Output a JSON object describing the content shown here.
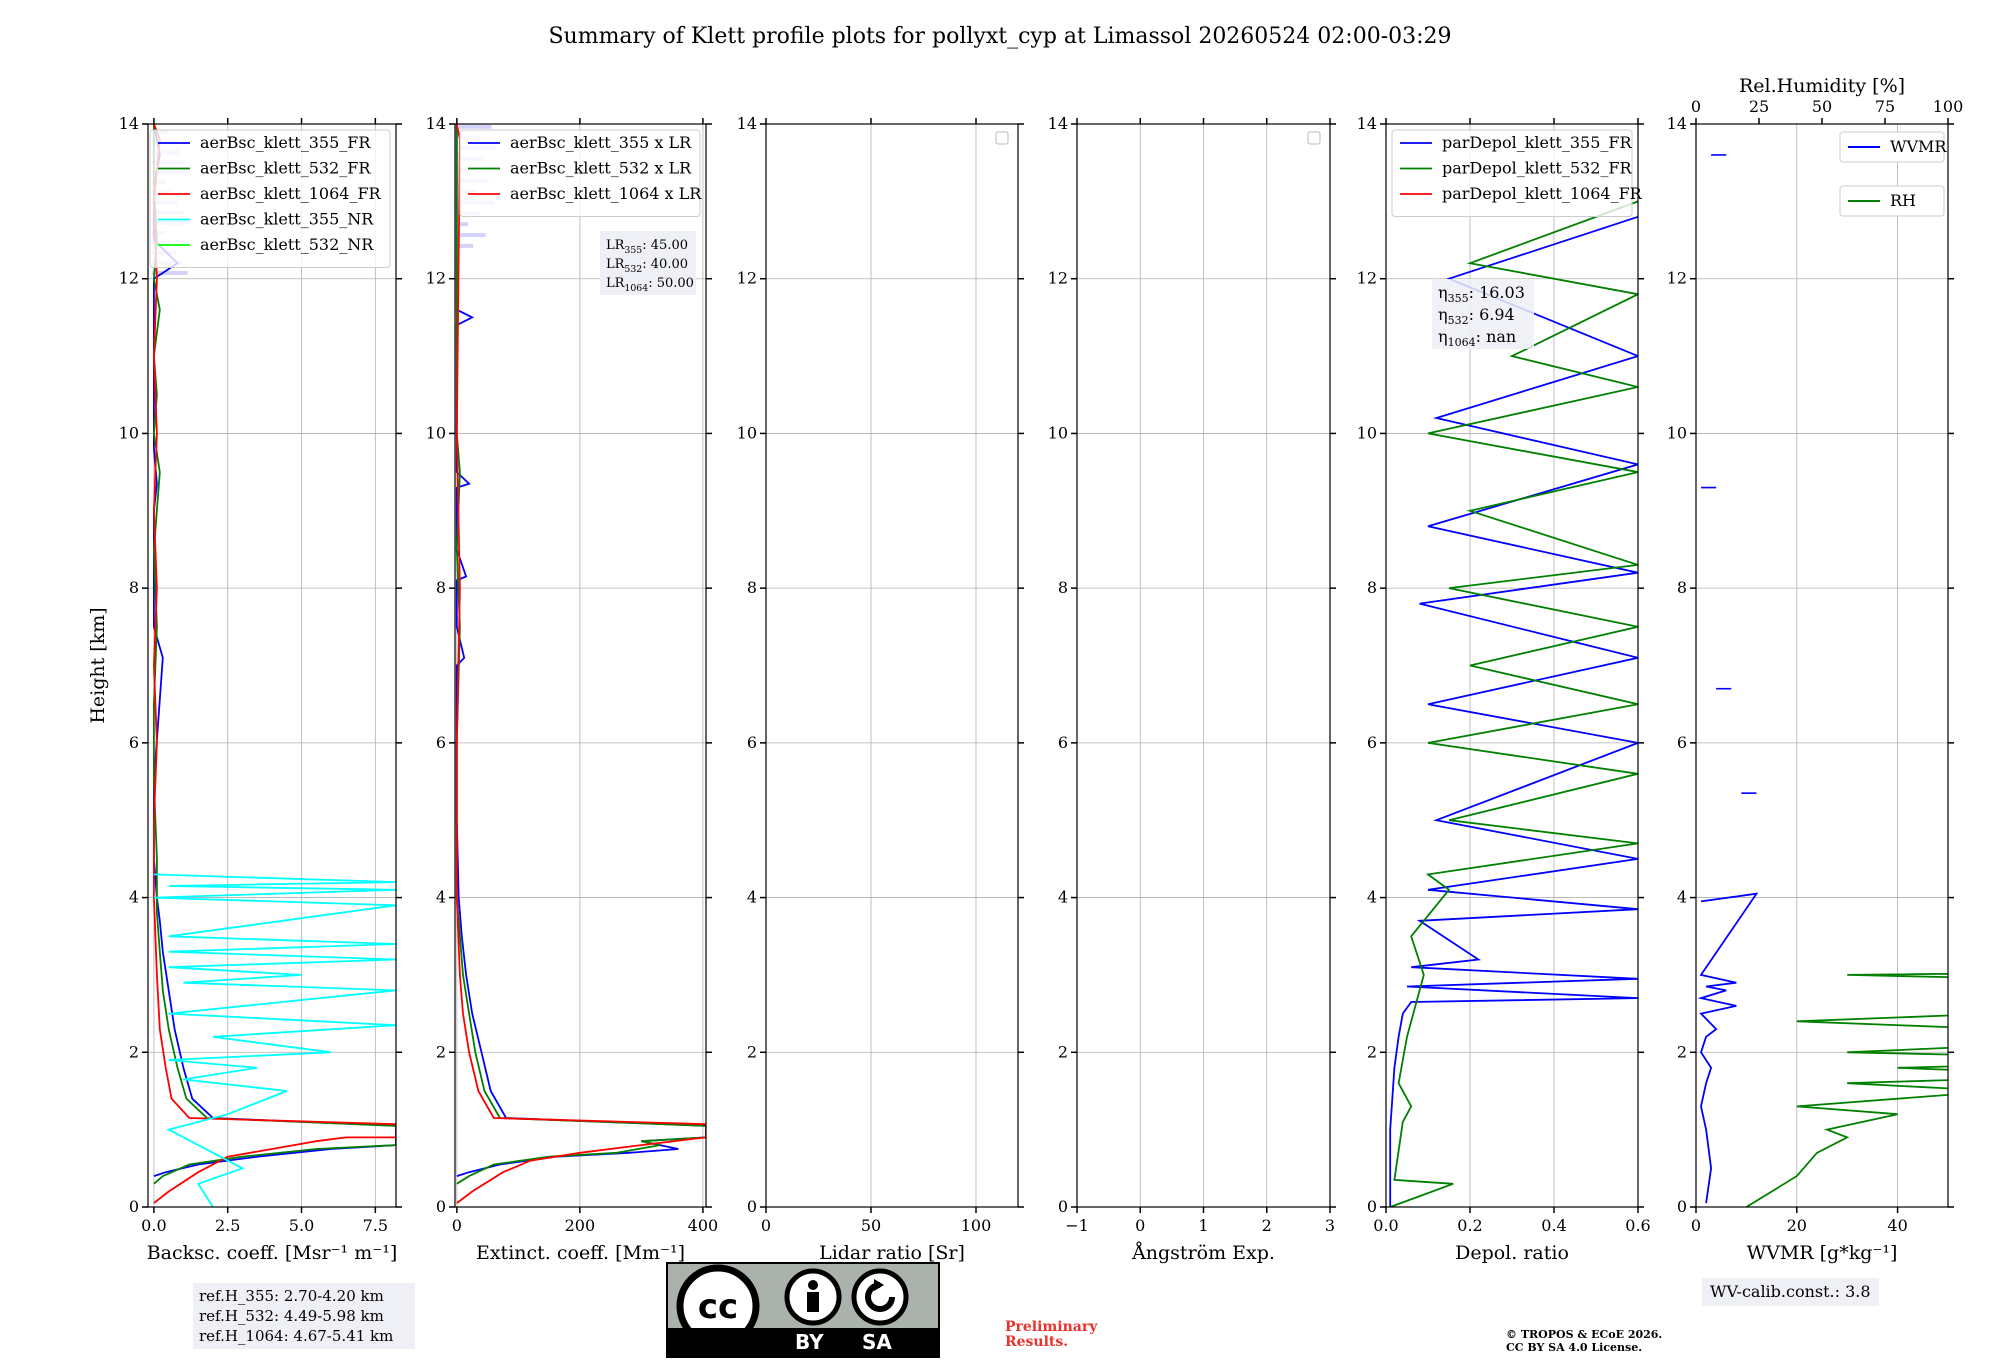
{
  "title": "Summary of Klett profile plots for pollyxt_cyp at Limassol 20260524 02:00-03:29",
  "colors": {
    "c355": "#0000ff",
    "c532": "#008000",
    "c1064": "#ff0000",
    "c355nr": "#00ffff",
    "c532nr": "#00ff00"
  },
  "chart_data": [
    {
      "type": "line",
      "panel": "backscatter",
      "xlabel": "Backsc. coeff. [Msr⁻¹ m⁻¹]",
      "ylabel": "Height [km]",
      "xlim": [
        -0.2,
        8.2
      ],
      "ylim": [
        0,
        14
      ],
      "xticks": [
        0,
        2.5,
        5,
        7.5
      ],
      "xticklabels": [
        "0.0",
        "2.5",
        "5.0",
        "7.5"
      ],
      "yticks": [
        0,
        2,
        4,
        6,
        8,
        10,
        12,
        14
      ],
      "legend": [
        "aerBsc_klett_355_FR",
        "aerBsc_klett_532_FR",
        "aerBsc_klett_1064_FR",
        "aerBsc_klett_355_NR",
        "aerBsc_klett_532_NR"
      ],
      "legend_loc": "upper right",
      "series": [
        {
          "name": "aerBsc_klett_355_FR",
          "color": "#0000ff",
          "x": [
            0.0,
            0.4,
            1.5,
            3.5,
            6.0,
            8.2,
            8.2,
            2.0,
            1.3,
            1.0,
            0.7,
            0.5,
            0.3,
            0.2,
            0.1,
            0.0,
            0.0,
            0.3,
            0.0,
            0.0,
            0.0,
            0.0,
            0.1,
            0.0,
            0.0,
            0.0,
            0.0,
            0.0,
            0.0,
            0.0,
            0.8,
            0.0,
            0.0,
            0.0,
            0.2,
            0.0
          ],
          "y": [
            0.4,
            0.45,
            0.55,
            0.65,
            0.75,
            0.8,
            1.05,
            1.15,
            1.4,
            1.8,
            2.3,
            2.8,
            3.3,
            3.7,
            4.0,
            4.5,
            5.5,
            7.1,
            7.5,
            8.1,
            8.5,
            9.0,
            9.35,
            9.8,
            10.5,
            11.0,
            11.4,
            11.5,
            11.7,
            12.0,
            12.2,
            12.5,
            12.8,
            13.2,
            13.6,
            14.0
          ]
        },
        {
          "name": "aerBsc_klett_532_FR",
          "color": "#008000",
          "x": [
            0.0,
            0.3,
            1.2,
            3.0,
            5.5,
            8.2,
            8.2,
            1.8,
            1.1,
            0.8,
            0.5,
            0.3,
            0.2,
            0.1,
            0.1,
            0.0,
            0.0,
            0.1,
            0.0,
            0.2,
            0.0,
            0.1,
            0.0,
            0.2,
            0.0,
            0.1,
            0.0,
            0.0
          ],
          "y": [
            0.3,
            0.4,
            0.55,
            0.65,
            0.75,
            0.8,
            1.05,
            1.15,
            1.4,
            1.8,
            2.3,
            2.8,
            3.3,
            3.8,
            4.5,
            5.5,
            6.5,
            7.5,
            8.5,
            9.5,
            10.0,
            10.5,
            11.0,
            11.6,
            12.0,
            12.5,
            13.2,
            14.0
          ]
        },
        {
          "name": "aerBsc_klett_1064_FR",
          "color": "#ff0000",
          "x": [
            0.0,
            0.5,
            1.5,
            2.5,
            4.0,
            5.5,
            6.5,
            8.2,
            8.2,
            1.2,
            0.6,
            0.4,
            0.2,
            0.1,
            0.0,
            0.0,
            0.1,
            0.0,
            0.1,
            0.0,
            0.1,
            0.0,
            0.1,
            0.0,
            0.2,
            0.0
          ],
          "y": [
            0.05,
            0.2,
            0.45,
            0.65,
            0.75,
            0.85,
            0.9,
            0.9,
            1.07,
            1.15,
            1.4,
            1.8,
            2.3,
            3.0,
            4.0,
            5.0,
            6.0,
            7.0,
            8.0,
            9.0,
            10.0,
            11.0,
            12.0,
            13.0,
            13.8,
            14.0
          ]
        },
        {
          "name": "aerBsc_klett_355_NR",
          "color": "#00ffff",
          "x": [
            2.0,
            1.5,
            3.0,
            2.0,
            0.5,
            2.5,
            4.5,
            1.0,
            3.5,
            0.5,
            6.0,
            2.0,
            8.2,
            0.5,
            8.2,
            1.0,
            5.0,
            0.5,
            8.2,
            0.5,
            8.2,
            0.5,
            8.2,
            0.0,
            8.2,
            0.5,
            8.2,
            0.0
          ],
          "y": [
            0.0,
            0.3,
            0.5,
            0.7,
            1.0,
            1.2,
            1.5,
            1.65,
            1.8,
            1.9,
            2.0,
            2.2,
            2.35,
            2.5,
            2.8,
            2.9,
            3.0,
            3.1,
            3.2,
            3.3,
            3.4,
            3.5,
            3.9,
            4.0,
            4.1,
            4.15,
            4.2,
            4.3
          ]
        },
        {
          "name": "aerBsc_klett_532_NR",
          "color": "#00ff00",
          "x": [],
          "y": []
        }
      ],
      "shaded_noise_top_km": [
        12.0,
        14.0
      ]
    },
    {
      "type": "line",
      "panel": "extinction",
      "xlabel": "Extinct. coeff. [Mm⁻¹]",
      "xlim": [
        -3,
        405
      ],
      "ylim": [
        0,
        14
      ],
      "xticks": [
        0,
        200,
        400
      ],
      "xticklabels": [
        "0",
        "200",
        "400"
      ],
      "yticks": [
        0,
        2,
        4,
        6,
        8,
        10,
        12,
        14
      ],
      "legend": [
        "aerBsc_klett_355 x LR",
        "aerBsc_klett_532 x LR",
        "aerBsc_klett_1064 x LR"
      ],
      "legend_loc": "upper right",
      "lidar_ratios": [
        "LR355: 45.00",
        "LR532: 40.00",
        "LR1064: 50.00"
      ],
      "series": [
        {
          "name": "aerBsc_klett_355 x LR",
          "color": "#0000ff",
          "x": [
            0,
            20,
            70,
            160,
            280,
            360,
            330,
            300,
            405,
            405,
            80,
            55,
            40,
            25,
            15,
            8,
            3,
            0,
            0,
            12,
            0,
            0,
            15,
            0,
            0,
            20,
            0,
            0,
            25,
            0,
            0
          ],
          "y": [
            0.4,
            0.45,
            0.55,
            0.65,
            0.7,
            0.75,
            0.8,
            0.85,
            0.9,
            1.05,
            1.15,
            1.5,
            2.0,
            2.5,
            3.0,
            3.5,
            4.0,
            5.0,
            7.0,
            7.1,
            7.5,
            8.1,
            8.15,
            8.5,
            9.3,
            9.35,
            9.5,
            11.4,
            11.5,
            11.6,
            14.0
          ]
        },
        {
          "name": "aerBsc_klett_532 x LR",
          "color": "#008000",
          "x": [
            0,
            20,
            60,
            150,
            260,
            330,
            300,
            405,
            405,
            70,
            45,
            30,
            20,
            10,
            5,
            0,
            0,
            5,
            0,
            5,
            0,
            0
          ],
          "y": [
            0.3,
            0.4,
            0.55,
            0.65,
            0.7,
            0.8,
            0.85,
            0.9,
            1.05,
            1.15,
            1.5,
            2.0,
            2.5,
            3.0,
            3.5,
            4.0,
            6.0,
            7.5,
            8.5,
            9.5,
            10.0,
            14.0
          ]
        },
        {
          "name": "aerBsc_klett_1064 x LR",
          "color": "#ff0000",
          "x": [
            0,
            25,
            75,
            120,
            200,
            300,
            405,
            405,
            60,
            35,
            20,
            10,
            5,
            0,
            0,
            5,
            0,
            5,
            0
          ],
          "y": [
            0.05,
            0.2,
            0.45,
            0.6,
            0.7,
            0.8,
            0.9,
            1.07,
            1.15,
            1.5,
            2.0,
            2.5,
            3.0,
            4.0,
            6.0,
            8.0,
            10.0,
            13.8,
            14.0
          ]
        }
      ]
    },
    {
      "type": "line",
      "panel": "lidar_ratio",
      "xlabel": "Lidar ratio [Sr]",
      "xlim": [
        0,
        120
      ],
      "ylim": [
        0,
        14
      ],
      "xticks": [
        0,
        50,
        100
      ],
      "xticklabels": [
        "0",
        "50",
        "100"
      ],
      "yticks": [
        0,
        2,
        4,
        6,
        8,
        10,
        12,
        14
      ],
      "series": []
    },
    {
      "type": "line",
      "panel": "angstrom",
      "xlabel": "Ångström Exp.",
      "xlim": [
        -1,
        3
      ],
      "ylim": [
        0,
        14
      ],
      "xticks": [
        -1,
        0,
        1,
        2,
        3
      ],
      "xticklabels": [
        "−1",
        "0",
        "1",
        "2",
        "3"
      ],
      "yticks": [
        0,
        2,
        4,
        6,
        8,
        10,
        12,
        14
      ],
      "series": []
    },
    {
      "type": "line",
      "panel": "depolarization",
      "xlabel": "Depol. ratio",
      "xlim": [
        0,
        0.6
      ],
      "ylim": [
        0,
        14
      ],
      "xticks": [
        0,
        0.2,
        0.4,
        0.6
      ],
      "xticklabels": [
        "0.0",
        "0.2",
        "0.4",
        "0.6"
      ],
      "yticks": [
        0,
        2,
        4,
        6,
        8,
        10,
        12,
        14
      ],
      "legend": [
        "parDepol_klett_355_FR",
        "parDepol_klett_532_FR",
        "parDepol_klett_1064_FR"
      ],
      "legend_loc": "upper right",
      "eta": [
        "η355: 16.03",
        "η532: 6.94",
        "η1064: nan"
      ],
      "series": [
        {
          "name": "parDepol_klett_355_FR",
          "color": "#0000ff",
          "x": [
            0.01,
            0.01,
            0.02,
            0.03,
            0.04,
            0.06,
            0.6,
            0.05,
            0.6,
            0.06,
            0.22,
            0.08,
            0.6,
            0.1,
            0.6,
            0.12,
            0.6,
            0.1,
            0.6,
            0.08,
            0.6,
            0.1,
            0.6,
            0.12,
            0.6,
            0.15,
            0.6
          ],
          "y": [
            0.0,
            1.0,
            1.8,
            2.2,
            2.5,
            2.65,
            2.7,
            2.85,
            2.95,
            3.1,
            3.2,
            3.7,
            3.85,
            4.1,
            4.5,
            5.0,
            6.0,
            6.5,
            7.1,
            7.8,
            8.2,
            8.8,
            9.6,
            10.2,
            11.0,
            12.0,
            12.8
          ]
        },
        {
          "name": "parDepol_klett_532_FR",
          "color": "#008000",
          "x": [
            0.01,
            0.16,
            0.02,
            0.04,
            0.06,
            0.03,
            0.05,
            0.09,
            0.06,
            0.15,
            0.1,
            0.6,
            0.15,
            0.6,
            0.1,
            0.6,
            0.2,
            0.6,
            0.15,
            0.6,
            0.2,
            0.6,
            0.1,
            0.6,
            0.3,
            0.6,
            0.2,
            0.6
          ],
          "y": [
            0.0,
            0.3,
            0.35,
            1.1,
            1.3,
            1.6,
            2.2,
            3.0,
            3.5,
            4.1,
            4.3,
            4.7,
            5.0,
            5.6,
            6.0,
            6.5,
            7.0,
            7.5,
            8.0,
            8.3,
            9.0,
            9.5,
            10.0,
            10.6,
            11.0,
            11.8,
            12.2,
            13.0
          ]
        },
        {
          "name": "parDepol_klett_1064_FR",
          "color": "#ff0000",
          "x": [],
          "y": []
        }
      ]
    },
    {
      "type": "line",
      "panel": "water_vapor",
      "xlabel": "WVMR [g*kg⁻¹]",
      "x2label": "Rel.Humidity [%]",
      "xlim": [
        0,
        50
      ],
      "x2lim": [
        0,
        100
      ],
      "ylim": [
        0,
        14
      ],
      "xticks": [
        0,
        20,
        40
      ],
      "xticklabels": [
        "0",
        "20",
        "40"
      ],
      "x2ticks": [
        0,
        25,
        50,
        75,
        100
      ],
      "x2ticklabels": [
        "0",
        "25",
        "50",
        "75",
        "100"
      ],
      "yticks": [
        0,
        2,
        4,
        6,
        8,
        10,
        12,
        14
      ],
      "legend": [
        "WVMR",
        "RH"
      ],
      "series": [
        {
          "name": "WVMR",
          "color": "#0000ff",
          "x": [
            2,
            3,
            2,
            1,
            2,
            3,
            1,
            2,
            4,
            1,
            8,
            1,
            6,
            2,
            8,
            1,
            12,
            1
          ],
          "y": [
            0.05,
            0.5,
            1.0,
            1.3,
            1.6,
            1.8,
            2.0,
            2.2,
            2.3,
            2.5,
            2.6,
            2.7,
            2.8,
            2.85,
            2.9,
            3.0,
            4.05,
            3.95
          ]
        },
        {
          "name": "RH",
          "color": "#008000",
          "x": [
            10,
            20,
            24,
            30,
            26,
            40,
            20,
            60,
            30,
            80,
            40,
            100,
            30,
            100,
            20,
            100,
            60,
            100,
            30,
            100
          ],
          "y": [
            0.0,
            0.4,
            0.7,
            0.9,
            1.0,
            1.2,
            1.3,
            1.5,
            1.6,
            1.7,
            1.8,
            1.9,
            2.0,
            2.2,
            2.4,
            2.6,
            2.8,
            2.9,
            3.0,
            3.05
          ]
        }
      ],
      "wvmr_segments_upper": [
        [
          1,
          9.3
        ],
        [
          4,
          6.7
        ],
        [
          9,
          5.35
        ],
        [
          3,
          13.6
        ]
      ]
    }
  ],
  "annotations": {
    "ref_heights": [
      "ref.H_355: 2.70-4.20 km",
      "ref.H_532: 4.49-5.98 km",
      "ref.H_1064: 4.67-5.41 km"
    ],
    "wv_calib": "WV-calib.const.: 3.8",
    "preliminary": [
      "Preliminary",
      "Results."
    ],
    "copyright": [
      "© TROPOS & ECoE 2026.",
      "CC BY SA 4.0 License."
    ],
    "cc_badge": {
      "by": "BY",
      "sa": "SA",
      "cc": "cc"
    }
  }
}
